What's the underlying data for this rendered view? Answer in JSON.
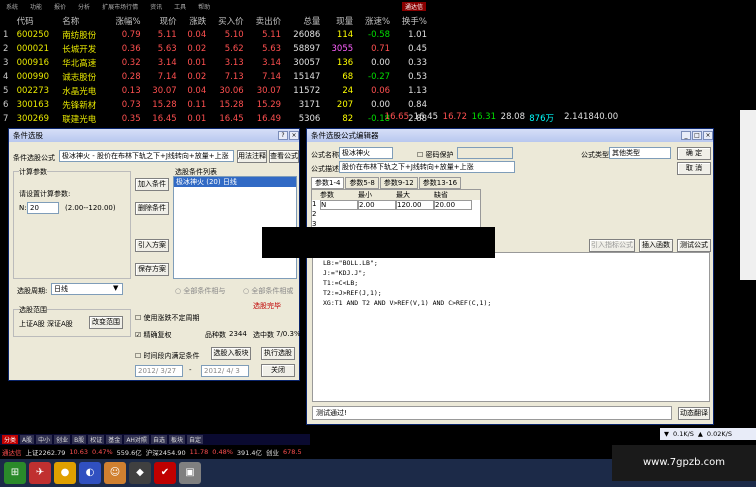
{
  "menu": {
    "items": [
      "系统",
      "功能",
      "报价",
      "分析",
      "扩展市场行情",
      "资讯",
      "工具",
      "帮助"
    ],
    "alert": "通达信"
  },
  "quote_table": {
    "headers": [
      "",
      "代码",
      "名称",
      "涨幅%",
      "现价",
      "涨跌",
      "买入价",
      "卖出价",
      "总量",
      "现量",
      "涨速%",
      "换手%"
    ],
    "rows": [
      {
        "idx": "1",
        "code": "600250",
        "name": "南纺股份",
        "pct": "0.79",
        "price": "5.11",
        "chg": "0.04",
        "bid": "5.10",
        "ask": "5.11",
        "vol": "26086",
        "cur": "114",
        "spd": "-0.58",
        "turn": "1.01"
      },
      {
        "idx": "2",
        "code": "000021",
        "name": "长城开发",
        "pct": "0.36",
        "price": "5.63",
        "chg": "0.02",
        "bid": "5.62",
        "ask": "5.63",
        "vol": "58897",
        "cur": "3055",
        "spd": "0.71",
        "turn": "0.45"
      },
      {
        "idx": "3",
        "code": "000916",
        "name": "华北高速",
        "pct": "0.32",
        "price": "3.14",
        "chg": "0.01",
        "bid": "3.13",
        "ask": "3.14",
        "vol": "30057",
        "cur": "136",
        "spd": "0.00",
        "turn": "0.33"
      },
      {
        "idx": "4",
        "code": "000990",
        "name": "诚志股份",
        "pct": "0.28",
        "price": "7.14",
        "chg": "0.02",
        "bid": "7.13",
        "ask": "7.14",
        "vol": "15147",
        "cur": "68",
        "spd": "-0.27",
        "turn": "0.53"
      },
      {
        "idx": "5",
        "code": "002273",
        "name": "水晶光电",
        "pct": "0.13",
        "price": "30.07",
        "chg": "0.04",
        "bid": "30.06",
        "ask": "30.07",
        "vol": "11572",
        "cur": "24",
        "spd": "0.06",
        "turn": "1.13"
      },
      {
        "idx": "6",
        "code": "300163",
        "name": "先锋新材",
        "pct": "0.73",
        "price": "15.28",
        "chg": "0.11",
        "bid": "15.28",
        "ask": "15.29",
        "vol": "3171",
        "cur": "207",
        "spd": "0.00",
        "turn": "0.84"
      },
      {
        "idx": "7",
        "code": "300269",
        "name": "联建光电",
        "pct": "0.35",
        "price": "16.45",
        "chg": "0.01",
        "bid": "16.45",
        "ask": "16.49",
        "vol": "5306",
        "cur": "82",
        "spd": "-0.18",
        "turn": "2.88"
      }
    ],
    "row7_extra": [
      "16.65",
      "16.45",
      "16.72",
      "16.31",
      "28.08",
      "876万",
      "2.14",
      "1840.00"
    ]
  },
  "select_dialog": {
    "title": "条件选股",
    "formula_label": "条件选股公式",
    "formula_value": "极冰神火 - 股价在布林下轨之下+J线转向+放量+上涨",
    "use_method": "用法注释",
    "view_formula": "查看公式",
    "params_group": "计算参数",
    "params_hint": "请设置计算参数:",
    "param_name": "N:",
    "param_value": "20",
    "param_range": "(2.00--120.00)",
    "add_cond": "加入条件",
    "del_cond": "删除条件",
    "import_plan": "引入方案",
    "save_plan": "保存方案",
    "cond_list_label": "选股条件列表",
    "cond_item": "极冰神火 (20) 日线",
    "period_label": "选股周期:",
    "period_value": "日线",
    "all_true": "全部条件相与",
    "all_or": "全部条件相或",
    "done": "选股完毕",
    "range_group": "选股范围",
    "range_value": "上证A股 深证A股",
    "change_range": "改变范围",
    "use_period": "使用涨跌不定周期",
    "precise": "精确复权",
    "count_label": "品种数",
    "count_value": "2344",
    "selected_label": "选中数",
    "selected_value": "7/0.3%",
    "time_cond": "时间段内满足条件",
    "to_board": "选股入板块",
    "run": "执行选股",
    "date_from": "2012/ 3/27",
    "date_to": "2012/ 4/ 3",
    "close": "关闭"
  },
  "editor": {
    "title": "条件选股公式编辑器",
    "name_label": "公式名称",
    "name_value": "极冰神火",
    "pwd": "密码保护",
    "desc_label": "公式描述",
    "desc_value": "股价在布林下轨之下+J线转向+放量+上涨",
    "type_label": "公式类型",
    "type_value": "其他类型",
    "ok": "确 定",
    "cancel": "取 消",
    "tabs": [
      "参数1-4",
      "参数5-8",
      "参数9-12",
      "参数13-16"
    ],
    "param_headers": [
      "参数",
      "最小",
      "最大",
      "缺省"
    ],
    "param_row": {
      "no": "1",
      "name": "N",
      "min": "2.00",
      "max": "120.00",
      "def": "20.00"
    },
    "row_nums": [
      "1",
      "2",
      "3",
      "4"
    ],
    "import_ind": "引入指标公式",
    "insert_fn": "插入函数",
    "test": "测试公式",
    "code_lines": [
      "LB:=\"BOLL.LB\";",
      "J:=\"KDJ.J\";",
      "T1:=C<LB;",
      "T2:=J>REF(J,1);",
      "XG:T1 AND T2 AND V>REF(V,1) AND C>REF(C,1);"
    ],
    "status": "测试通过!",
    "translate": "动态翻译"
  },
  "tabbar": [
    "分类",
    "A股",
    "中小",
    "创业",
    "B股",
    "权证",
    "基金",
    "AH对照",
    "自选",
    "板块",
    "自定"
  ],
  "statusbar": {
    "label": "通达信",
    "sh": "上证2262.79",
    "sh_chg": "10.63",
    "sh_pct": "0.47%",
    "sh_amt": "559.6亿",
    "sz": "沪深2454.90",
    "sz_chg": "11.78",
    "sz_pct": "0.48%",
    "sz_amt": "391.4亿",
    "cy": "创业",
    "cy_val": "678.5"
  },
  "net_speed": "0.1K/S",
  "net_speed2": "0.02K/S",
  "watermark": "www.7gpzb.com"
}
